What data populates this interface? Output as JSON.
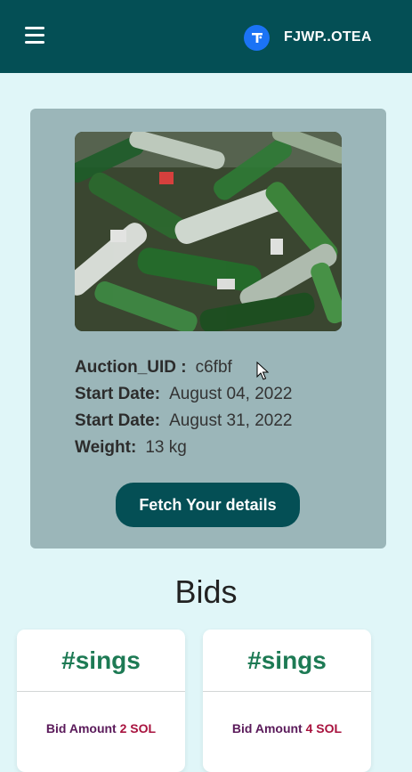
{
  "header": {
    "wallet_label": "FJWP..OTEA",
    "wallet_icon": "wallet-t-icon",
    "bg_color": "#044f55"
  },
  "auction": {
    "image_icon": "glass-bottles-photo",
    "fields": [
      {
        "key": "Auction_UID :",
        "value": "c6fbf"
      },
      {
        "key": "Start Date:",
        "value": "August 04, 2022"
      },
      {
        "key": "Start Date:",
        "value": "August 31, 2022"
      },
      {
        "key": "Weight:",
        "value": "13 kg"
      }
    ],
    "fetch_button": "Fetch Your details"
  },
  "bids": {
    "title": "Bids",
    "items": [
      {
        "tag": "#sings",
        "prefix": "Bid Amount",
        "amount": "2 SOL"
      },
      {
        "tag": "#sings",
        "prefix": "Bid Amount",
        "amount": "4 SOL"
      }
    ]
  }
}
